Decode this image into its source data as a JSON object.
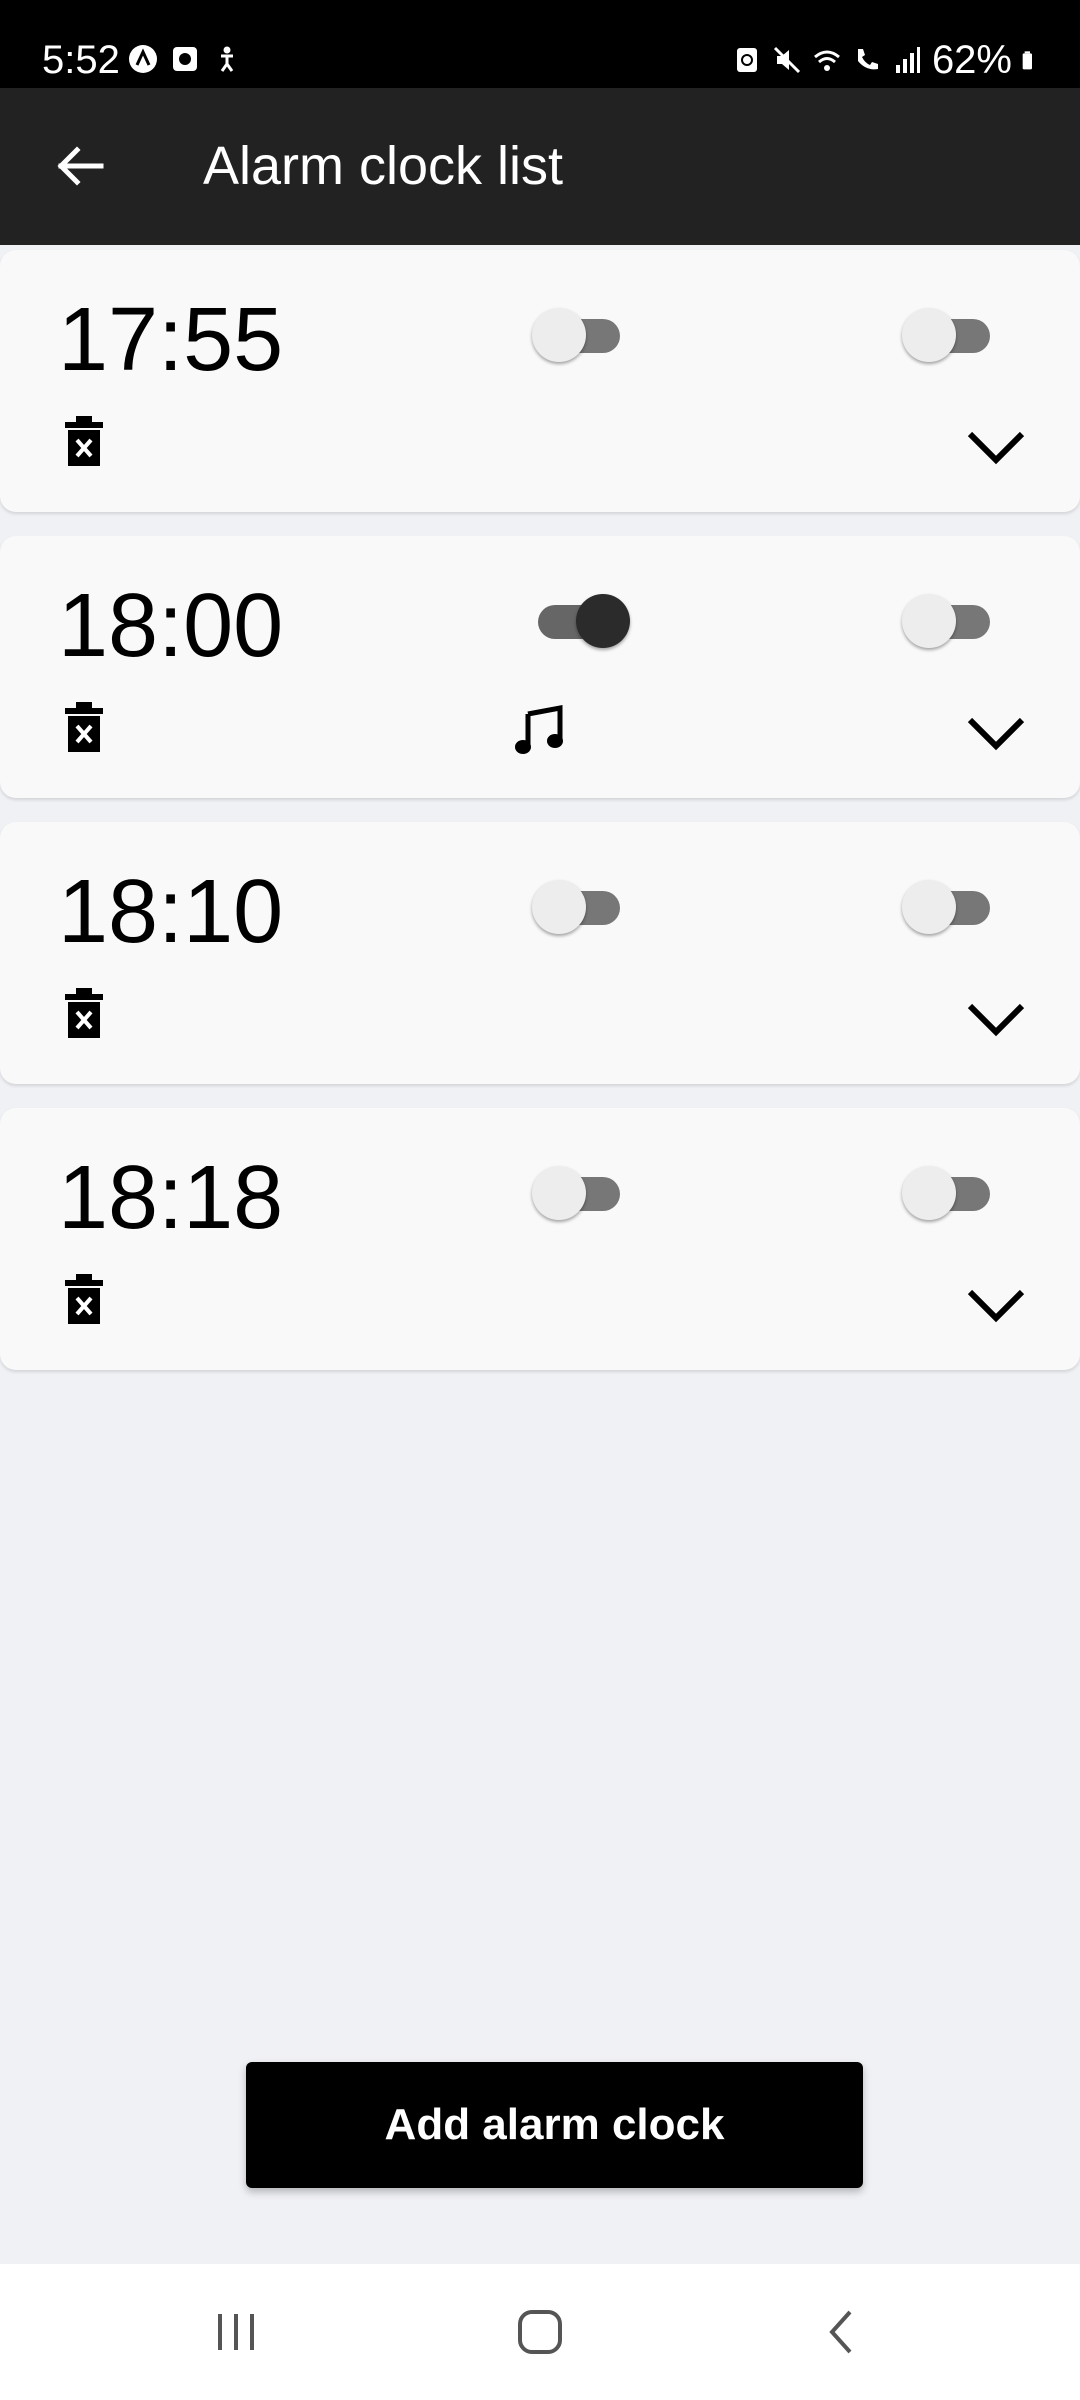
{
  "status_bar": {
    "time": "5:52",
    "battery_percent": "62%",
    "left_icons": [
      "launcher-icon",
      "screen-record-icon",
      "accessibility-icon"
    ],
    "right_icons": [
      "sync-icon",
      "mute-icon",
      "wifi-icon",
      "wifi-calling-icon",
      "signal-icon",
      "battery-icon"
    ]
  },
  "app_bar": {
    "title": "Alarm clock list",
    "back_icon": "arrow-left-icon"
  },
  "alarms": [
    {
      "time": "17:55",
      "toggle_1": false,
      "toggle_2": false,
      "music": false
    },
    {
      "time": "18:00",
      "toggle_1": true,
      "toggle_2": false,
      "music": true
    },
    {
      "time": "18:10",
      "toggle_1": false,
      "toggle_2": false,
      "music": false
    },
    {
      "time": "18:18",
      "toggle_1": false,
      "toggle_2": false,
      "music": false
    }
  ],
  "add_button": {
    "label": "Add alarm clock"
  },
  "colors": {
    "status_bar_bg": "#000000",
    "app_bar_bg": "#222222",
    "page_bg": "#f0f1f5",
    "card_bg": "#f9f9f9",
    "button_bg": "#000000"
  }
}
